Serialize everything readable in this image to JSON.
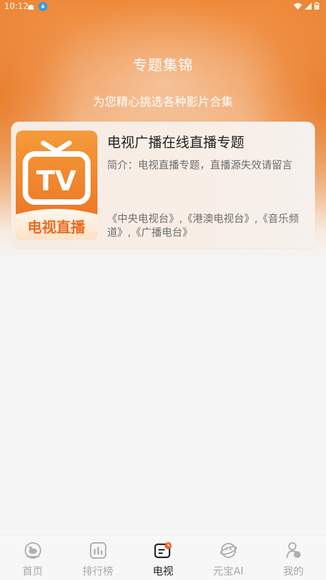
{
  "status_bar": {
    "time": "10:12"
  },
  "header": {
    "title": "专题集锦",
    "subtitle": "为您精心挑选各种影片合集"
  },
  "topic_card": {
    "cover_tv_text": "TV",
    "cover_caption": "电视直播",
    "title": "电视广播在线直播专题",
    "description": "简介：电视直播专题，直播源失效请留言",
    "channels": "《中央电视台》,《港澳电视台》,《音乐频道》,《广播电台》"
  },
  "tab_bar": {
    "items": [
      {
        "label": "首页",
        "icon": "home-icon"
      },
      {
        "label": "排行榜",
        "icon": "chart-icon"
      },
      {
        "label": "电视",
        "icon": "tv-icon",
        "active": true
      },
      {
        "label": "元宝AI",
        "icon": "ai-icon"
      },
      {
        "label": "我的",
        "icon": "profile-icon"
      }
    ]
  },
  "colors": {
    "accent_orange": "#ef8a3a",
    "tab_active": "#222222",
    "tab_inactive": "#a8a8a8"
  }
}
